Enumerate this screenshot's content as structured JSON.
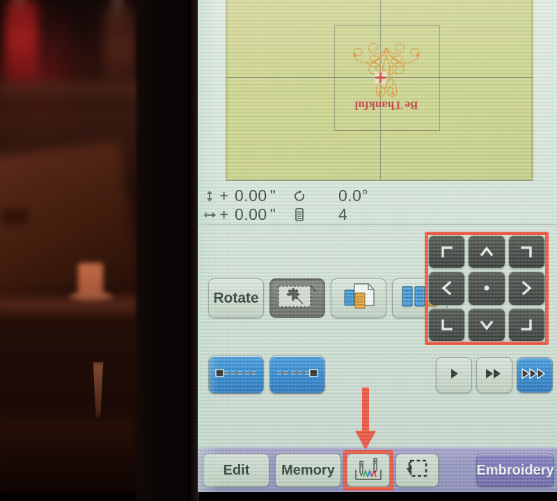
{
  "device": {
    "kind": "embroidery-machine-lcd",
    "screen_bg": "#d6e4d8",
    "hoop_bg": "#cbd07c",
    "accent_blue": "#1476cf",
    "accent_purple": "#6a61b4",
    "annotation_red": "#fb3a22"
  },
  "design": {
    "text": "Be Thankful",
    "orientation": "rotated-180",
    "thread_outline_color": "#e08a1e",
    "thread_text_color": "#c01f28",
    "center_marker_color": "#d81f20"
  },
  "status": {
    "vertical_offset_icon": "vertical-arrows-icon",
    "vertical_offset_sign": "+",
    "vertical_offset_value": "0.00",
    "vertical_offset_unit": "\"",
    "horizontal_offset_icon": "horizontal-arrows-icon",
    "horizontal_offset_sign": "+",
    "horizontal_offset_value": "0.00",
    "horizontal_offset_unit": "\"",
    "rotation_icon": "rotation-icon",
    "rotation_value": "0.0°",
    "color_count_icon": "thread-spool-icon",
    "color_count_value": "4"
  },
  "controls": {
    "row1": [
      {
        "name": "rotate-button",
        "label": "Rotate",
        "icon": null,
        "state": "normal"
      },
      {
        "name": "trace-design-button",
        "label": "",
        "icon": "design-trace-icon",
        "state": "pressed"
      },
      {
        "name": "thread-list-button",
        "label": "",
        "icon": "thread-page-icon",
        "state": "normal"
      },
      {
        "name": "color-list-button",
        "label": "",
        "icon": "three-spools-icon",
        "state": "normal"
      }
    ],
    "row2": [
      {
        "name": "start-position-button",
        "label": "",
        "icon": "stitch-start-icon",
        "state": "blue"
      },
      {
        "name": "end-position-button",
        "label": "",
        "icon": "stitch-end-icon",
        "state": "blue"
      }
    ],
    "navpad": [
      {
        "name": "nav-top-left",
        "icon": "corner-top-left-icon"
      },
      {
        "name": "nav-up",
        "icon": "chevron-up-icon"
      },
      {
        "name": "nav-top-right",
        "icon": "corner-top-right-icon"
      },
      {
        "name": "nav-left",
        "icon": "chevron-left-icon"
      },
      {
        "name": "nav-center",
        "icon": "center-dot-icon"
      },
      {
        "name": "nav-right",
        "icon": "chevron-right-icon"
      },
      {
        "name": "nav-bottom-left",
        "icon": "corner-bottom-left-icon"
      },
      {
        "name": "nav-down",
        "icon": "chevron-down-icon"
      },
      {
        "name": "nav-bottom-right",
        "icon": "corner-bottom-right-icon"
      }
    ],
    "playback": [
      {
        "name": "play-button",
        "icon": "play-icon",
        "state": "normal"
      },
      {
        "name": "forward-button",
        "icon": "fast-forward-icon",
        "state": "normal"
      },
      {
        "name": "fast-forward-button",
        "icon": "triple-forward-icon",
        "state": "selected"
      }
    ]
  },
  "bottom_bar": {
    "edit_label": "Edit",
    "memory_label": "Memory",
    "needle_icon": "needle-thread-icon",
    "frame_icon": "hoop-return-icon",
    "embroidery_label": "Embroidery"
  },
  "annotations": {
    "navpad_box": "red-highlight-box",
    "needle_box": "red-highlight-box",
    "arrow": "red-down-arrow"
  }
}
